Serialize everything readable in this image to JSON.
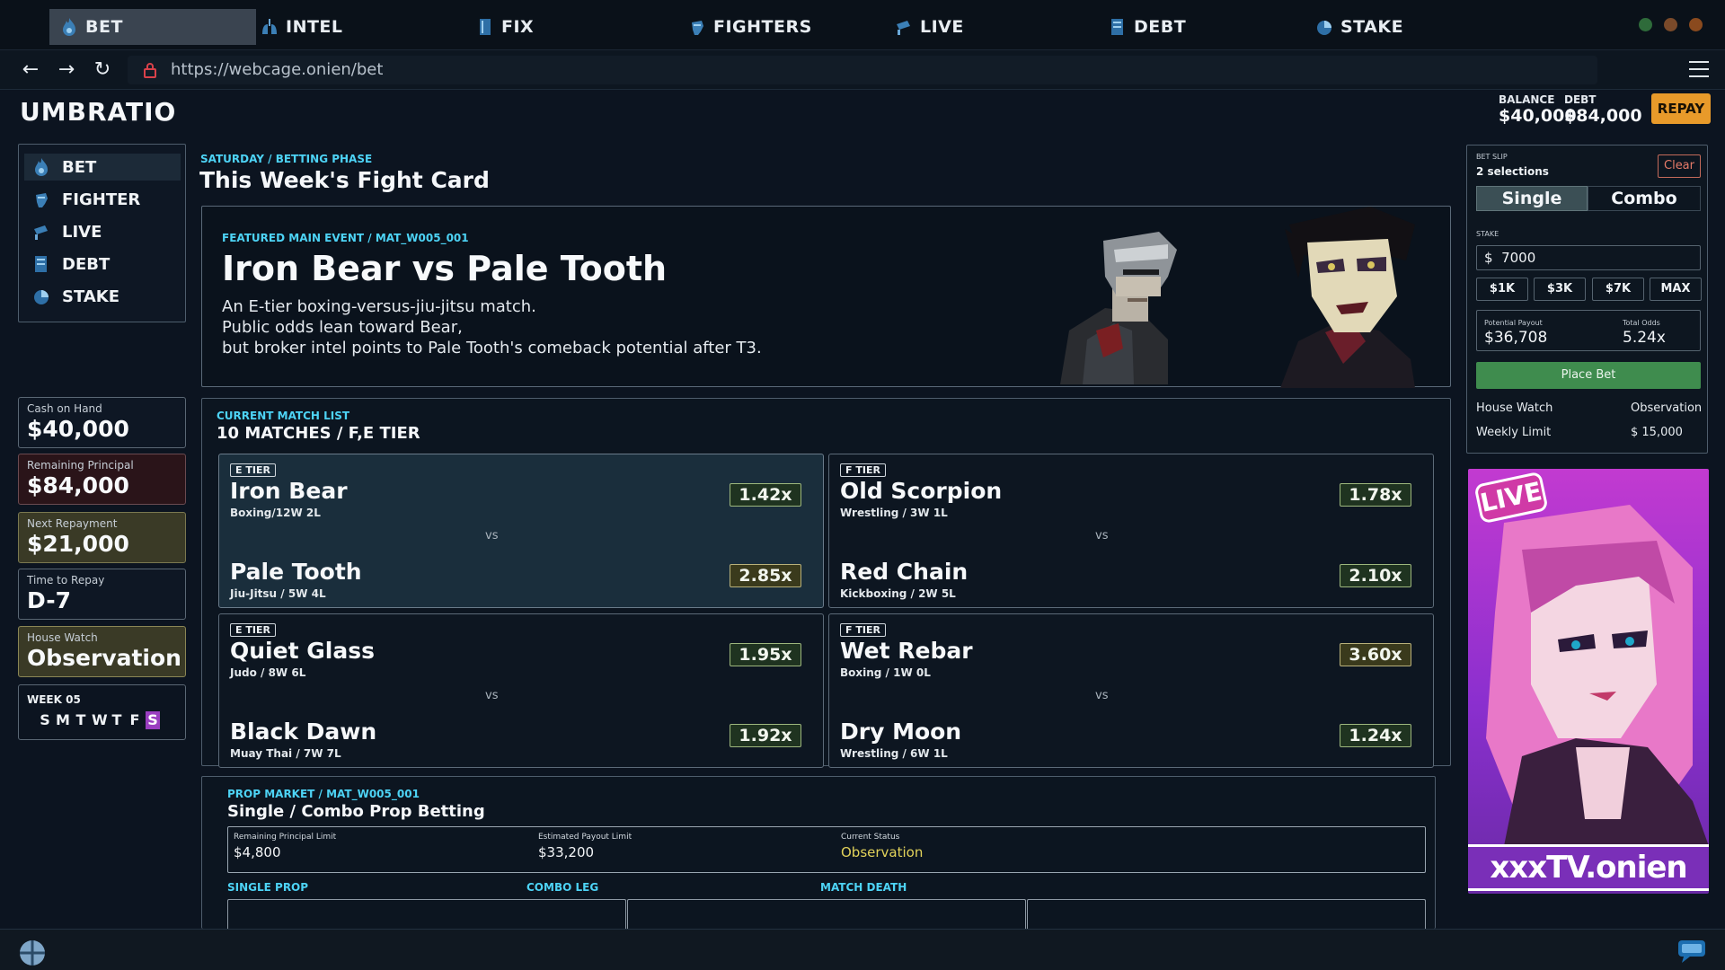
{
  "tabs": [
    {
      "label": "BET",
      "icon": "flame-icon"
    },
    {
      "label": "INTEL",
      "icon": "lungs-icon"
    },
    {
      "label": "FIX",
      "icon": "book-icon"
    },
    {
      "label": "FIGHTERS",
      "icon": "fist-icon"
    },
    {
      "label": "LIVE",
      "icon": "camera-icon"
    },
    {
      "label": "DEBT",
      "icon": "ledger-icon"
    },
    {
      "label": "STAKE",
      "icon": "pie-icon"
    }
  ],
  "window_dots": [
    "#2e6b3a",
    "#7a4a2a",
    "#8a4a1e"
  ],
  "address": {
    "url": "https://webcage.onien/bet"
  },
  "app": {
    "brand": "UMBRATIO",
    "balance_label": "BALANCE",
    "balance_value": "$40,000",
    "debt_label": "DEBT",
    "debt_value": "$84,000",
    "repay_label": "REPAY"
  },
  "sidebar": {
    "items": [
      {
        "label": "BET",
        "icon": "flame-icon"
      },
      {
        "label": "FIGHTER",
        "icon": "fist-icon"
      },
      {
        "label": "LIVE",
        "icon": "camera-icon"
      },
      {
        "label": "DEBT",
        "icon": "ledger-icon"
      },
      {
        "label": "STAKE",
        "icon": "pie-icon"
      }
    ]
  },
  "stats": [
    {
      "label": "Cash on Hand",
      "value": "$40,000",
      "bg": "#0e1724",
      "border": "#5a6774"
    },
    {
      "label": "Remaining Principal",
      "value": "$84,000",
      "bg": "#2a1419",
      "border": "#6a4a50"
    },
    {
      "label": "Next Repayment",
      "value": "$21,000",
      "bg": "#3a3a26",
      "border": "#7a7850"
    },
    {
      "label": "Time to Repay",
      "value": "D-7",
      "bg": "#0e1724",
      "border": "#5a6774"
    },
    {
      "label": "House Watch",
      "value": "Observation",
      "bg": "#3a3a26",
      "border": "#8a8655"
    }
  ],
  "week": {
    "label": "WEEK 05",
    "days": [
      "S",
      "M",
      "T",
      "W",
      "T",
      "F",
      "S"
    ],
    "active_index": 6
  },
  "main": {
    "phase": "SATURDAY / BETTING PHASE",
    "title": "This Week's Fight Card"
  },
  "featured": {
    "tag": "FEATURED MAIN EVENT / MAT_W005_001",
    "title": "Iron Bear vs Pale Tooth",
    "desc": [
      "An E-tier boxing-versus-jiu-jitsu match.",
      "Public odds lean toward Bear,",
      "but broker intel points to Pale Tooth's comeback potential after T3."
    ]
  },
  "matchlist": {
    "tag": "CURRENT MATCH LIST",
    "title": "10 MATCHES / F,E TIER",
    "vs_label": "vs",
    "matches": [
      {
        "tier": "E TIER",
        "a": {
          "name": "Iron Bear",
          "record": "Boxing/12W 2L",
          "odds": "1.42x"
        },
        "b": {
          "name": "Pale Tooth",
          "record": "Jiu-Jitsu / 5W 4L",
          "odds": "2.85x"
        }
      },
      {
        "tier": "F TIER",
        "a": {
          "name": "Old Scorpion",
          "record": "Wrestling / 3W 1L",
          "odds": "1.78x"
        },
        "b": {
          "name": "Red Chain",
          "record": "Kickboxing / 2W 5L",
          "odds": "2.10x"
        }
      },
      {
        "tier": "E TIER",
        "a": {
          "name": "Quiet Glass",
          "record": "Judo / 8W 6L",
          "odds": "1.95x"
        },
        "b": {
          "name": "Black Dawn",
          "record": "Muay Thai / 7W 7L",
          "odds": "1.92x"
        }
      },
      {
        "tier": "F TIER",
        "a": {
          "name": "Wet Rebar",
          "record": "Boxing / 1W 0L",
          "odds": "3.60x"
        },
        "b": {
          "name": "Dry Moon",
          "record": "Wrestling / 6W 1L",
          "odds": "1.24x"
        }
      }
    ]
  },
  "prop": {
    "tag": "PROP MARKET / MAT_W005_001",
    "title": "Single / Combo Prop Betting",
    "stats": [
      {
        "label": "Remaining Principal Limit",
        "value": "$4,800"
      },
      {
        "label": "Estimated Payout Limit",
        "value": "$33,200"
      },
      {
        "label": "Current Status",
        "value": "Observation"
      }
    ],
    "columns": [
      "SINGLE PROP",
      "COMBO LEG",
      "MATCH DEATH"
    ]
  },
  "betslip": {
    "label": "BET SLIP",
    "count": "2 selections",
    "clear": "Clear",
    "single": "Single",
    "combo": "Combo",
    "stake_label": "STAKE",
    "stake_value": "$  7000",
    "chips": [
      "$1K",
      "$3K",
      "$7K",
      "MAX"
    ],
    "payout_label": "Potential Payout",
    "payout_value": "$36,708",
    "odds_label": "Total Odds",
    "odds_value": "5.24x",
    "place": "Place Bet",
    "rows": [
      {
        "k": "House Watch",
        "v": "Observation"
      },
      {
        "k": "Weekly Limit",
        "v": "$ 15,000"
      }
    ]
  },
  "ad": {
    "badge": "LIVE",
    "label": "xxxTV.onien"
  }
}
